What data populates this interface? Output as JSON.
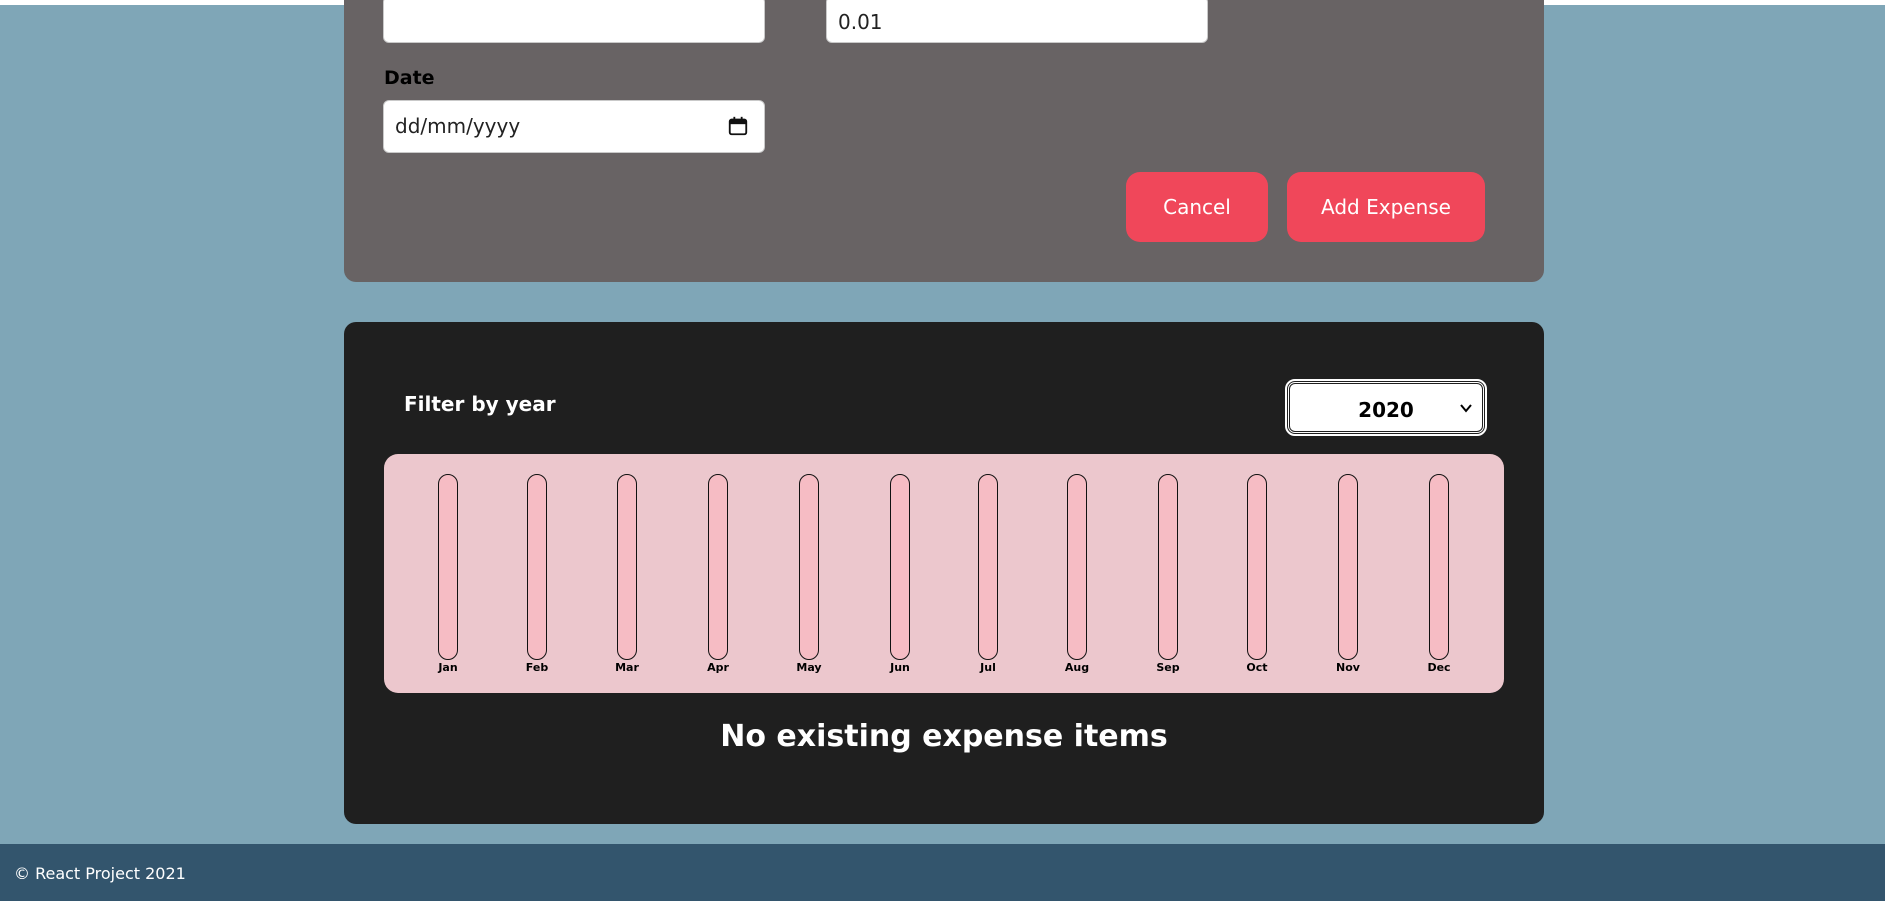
{
  "expense_form": {
    "title_value": "",
    "amount_value": "0.01",
    "date_label": "Date",
    "date_placeholder": "dd/mm/yyyy",
    "cancel_label": "Cancel",
    "add_label": "Add Expense"
  },
  "expenses": {
    "filter_label": "Filter by year",
    "selected_year": "2020",
    "empty_message": "No existing expense items"
  },
  "chart_data": {
    "type": "bar",
    "categories": [
      "Jan",
      "Feb",
      "Mar",
      "Apr",
      "May",
      "Jun",
      "Jul",
      "Aug",
      "Sep",
      "Oct",
      "Nov",
      "Dec"
    ],
    "values": [
      0,
      0,
      0,
      0,
      0,
      0,
      0,
      0,
      0,
      0,
      0,
      0
    ],
    "title": "",
    "xlabel": "",
    "ylabel": ""
  },
  "footer": {
    "text": "© React Project 2021"
  },
  "colors": {
    "page_background": "#7fa6b7",
    "form_card": "#686364",
    "expenses_card": "#1f1f1f",
    "button": "#f0475a",
    "chart_background": "#ecc7cd",
    "bar_track": "#f6bcc4",
    "footer": "#33556d"
  },
  "icons": {
    "date_picker": "calendar-icon",
    "select_dropdown": "chevron-down-icon"
  }
}
